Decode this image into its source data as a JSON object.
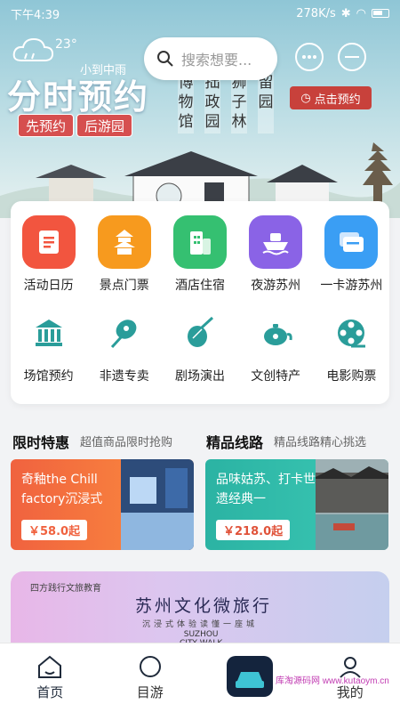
{
  "status_bar": {
    "time": "下午4:39",
    "network": "278K/s"
  },
  "hero": {
    "temperature": "23°",
    "weather": "小到中雨",
    "title": "分时预约",
    "tags": [
      "先预约",
      "后游园"
    ],
    "venues": [
      "博物馆",
      "拙政园",
      "狮子林",
      "留园"
    ],
    "reserve_label": "点击预约"
  },
  "search": {
    "placeholder": "搜索想要..."
  },
  "quick_grid": [
    {
      "label": "活动日历",
      "icon": "calendar-icon",
      "color": "#f2553f"
    },
    {
      "label": "景点门票",
      "icon": "pagoda-icon",
      "color": "#f79a1e"
    },
    {
      "label": "酒店住宿",
      "icon": "building-icon",
      "color": "#35c071"
    },
    {
      "label": "夜游苏州",
      "icon": "boat-icon",
      "color": "#8a63e6"
    },
    {
      "label": "一卡游苏州",
      "icon": "card-icon",
      "color": "#3a9ef4"
    },
    {
      "label": "场馆预约",
      "icon": "museum-icon",
      "color": "#2a9d9a"
    },
    {
      "label": "非遗专卖",
      "icon": "fan-icon",
      "color": "#2a9d9a"
    },
    {
      "label": "剧场演出",
      "icon": "pipa-icon",
      "color": "#2a9d9a"
    },
    {
      "label": "文创特产",
      "icon": "teapot-icon",
      "color": "#2a9d9a"
    },
    {
      "label": "电影购票",
      "icon": "film-reel-icon",
      "color": "#2a9d9a"
    }
  ],
  "sections": {
    "left": {
      "title": "限时特惠",
      "subtitle": "超值商品限时抢购"
    },
    "right": {
      "title": "精品线路",
      "subtitle": "精品线路精心挑选"
    }
  },
  "promos": [
    {
      "text": "奇釉the Chill factory沉浸式",
      "price": "￥58.0起",
      "price_color": "#f0623f"
    },
    {
      "text": "品味姑苏、打卡世遗经典一",
      "price": "￥218.0起",
      "price_color": "#e0533a"
    }
  ],
  "banner": {
    "brand": "四方践行文旅教育",
    "title": "苏州文化微旅行",
    "subtitle": "沉浸式体验读懂一座城",
    "logo_line1": "SUZHOU",
    "logo_line2": "CITY WALK"
  },
  "bottom_nav": [
    {
      "label": "首页",
      "icon": "home-icon",
      "active": true
    },
    {
      "label": "目游",
      "icon": "explore-icon",
      "active": false
    },
    {
      "label": "",
      "icon": "app-badge-icon",
      "active": false
    },
    {
      "label": "我的",
      "icon": "profile-icon",
      "active": false
    }
  ],
  "watermark": "库淘源码网 www.kutaoym.cn"
}
